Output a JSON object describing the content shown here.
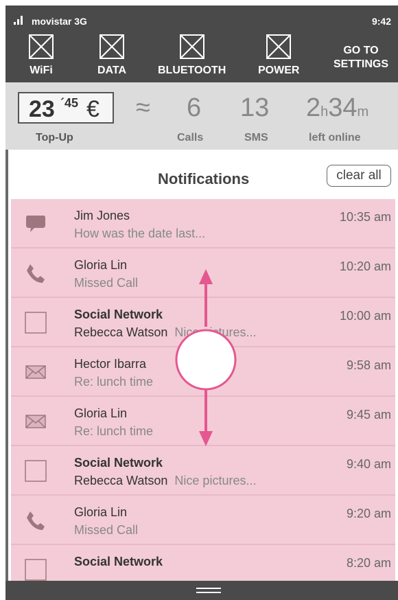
{
  "status": {
    "carrier": "movistar 3G",
    "time": "9:42"
  },
  "toggles": [
    {
      "label": "WiFi",
      "icon": "wifi-toggle-placeholder-icon"
    },
    {
      "label": "DATA",
      "icon": "data-toggle-placeholder-icon"
    },
    {
      "label": "BLUETOOTH",
      "icon": "bluetooth-toggle-placeholder-icon"
    },
    {
      "label": "POWER",
      "icon": "power-toggle-placeholder-icon"
    }
  ],
  "go_to_settings": {
    "line1": "GO TO",
    "line2": "SETTINGS"
  },
  "summary": {
    "topup_int": "23",
    "topup_dec": "´45",
    "topup_currency": "€",
    "topup_label": "Top-Up",
    "approx": "≈",
    "calls_value": "6",
    "calls_label": "Calls",
    "sms_value": "13",
    "sms_label": "SMS",
    "online_hours": "2",
    "online_h_unit": "h",
    "online_minutes": "34",
    "online_m_unit": "m",
    "online_label": "left online"
  },
  "notifications": {
    "title": "Notifications",
    "clear_label": "clear all",
    "items": [
      {
        "icon": "chat-icon",
        "sender": "Jim Jones",
        "bold": false,
        "person": "",
        "text": "How was the date last...",
        "time": "10:35 am"
      },
      {
        "icon": "phone-icon",
        "sender": "Gloria Lin",
        "bold": false,
        "person": "",
        "text": "Missed Call",
        "time": "10:20 am"
      },
      {
        "icon": "social-icon",
        "sender": "Social Network",
        "bold": true,
        "person": "Rebecca Watson",
        "text": "Nice pictures...",
        "time": "10:00 am"
      },
      {
        "icon": "mail-icon",
        "sender": "Hector Ibarra",
        "bold": false,
        "person": "",
        "text": "Re: lunch time",
        "time": "9:58 am"
      },
      {
        "icon": "mail-icon",
        "sender": "Gloria Lin",
        "bold": false,
        "person": "",
        "text": "Re: lunch time",
        "time": "9:45 am"
      },
      {
        "icon": "social-icon",
        "sender": "Social Network",
        "bold": true,
        "person": "Rebecca Watson",
        "text": "Nice pictures...",
        "time": "9:40 am"
      },
      {
        "icon": "phone-icon",
        "sender": "Gloria Lin",
        "bold": false,
        "person": "",
        "text": "Missed Call",
        "time": "9:20 am"
      },
      {
        "icon": "social-icon",
        "sender": "Social Network",
        "bold": true,
        "person": "",
        "text": "",
        "time": "8:20 am"
      }
    ]
  },
  "colors": {
    "bar": "#4a4a4a",
    "row_bg": "#f3ccd8",
    "gesture": "#e5578f",
    "icon": "#9e7680"
  }
}
